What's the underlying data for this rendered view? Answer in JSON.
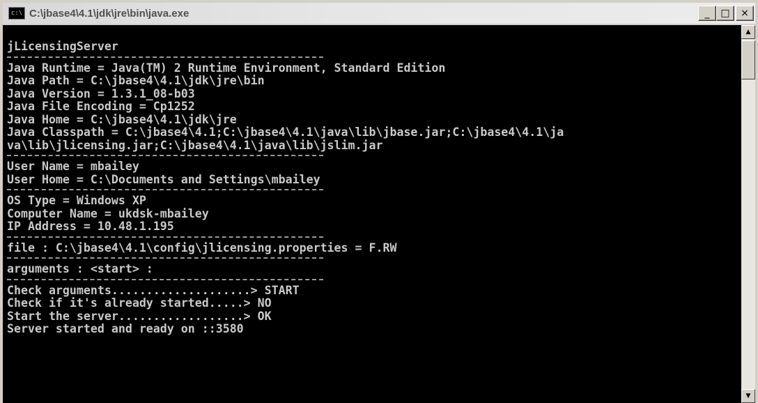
{
  "window": {
    "title": "C:\\jbase4\\4.1\\jdk\\jre\\bin\\java.exe",
    "icon_text": "c:\\",
    "buttons": {
      "minimize": "_",
      "maximize": "□",
      "close": "×"
    }
  },
  "console": {
    "blocks": [
      [
        "jLicensingServer"
      ],
      [
        "Java Runtime = Java(TM) 2 Runtime Environment, Standard Edition",
        "Java Path = C:\\jbase4\\4.1\\jdk\\jre\\bin",
        "Java Version = 1.3.1_08-b03",
        "Java File Encoding = Cp1252",
        "Java Home = C:\\jbase4\\4.1\\jdk\\jre",
        "Java Classpath = C:\\jbase4\\4.1;C:\\jbase4\\4.1\\java\\lib\\jbase.jar;C:\\jbase4\\4.1\\ja",
        "va\\lib\\jlicensing.jar;C:\\jbase4\\4.1\\java\\lib\\jslim.jar"
      ],
      [
        "User Name = mbailey",
        "User Home = C:\\Documents and Settings\\mbailey"
      ],
      [
        "OS Type = Windows XP",
        "Computer Name = ukdsk-mbailey",
        "IP Address = 10.48.1.195"
      ],
      [
        "file : C:\\jbase4\\4.1\\config\\jlicensing.properties = F.RW"
      ],
      [
        "arguments : <start> :"
      ],
      [
        "Check arguments....................> START",
        "Check if it's already started.....> NO",
        "Start the server..................> OK",
        "Server started and ready on ::3580"
      ]
    ]
  },
  "colors": {
    "console_bg": "#000000",
    "console_text": "#c9c9c9",
    "titlebar_text": "#505050",
    "chrome": "#d4d0c8"
  }
}
